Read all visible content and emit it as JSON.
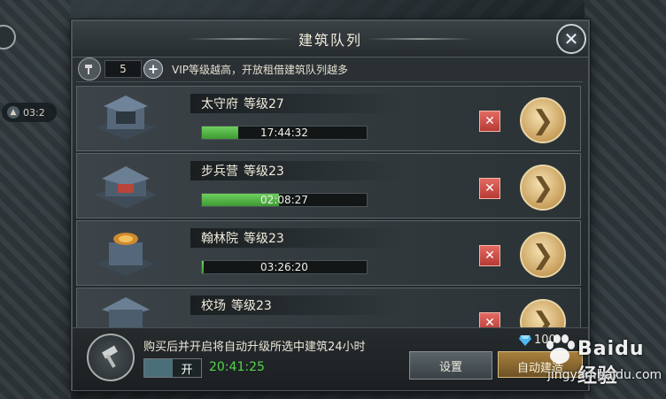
{
  "dialog": {
    "title": "建筑队列"
  },
  "queue_info": {
    "count": "5",
    "vip_note": "VIP等级越高，开放租借建筑队列越多"
  },
  "background": {
    "ghost_timer": "03:2"
  },
  "buildings": [
    {
      "name": "太守府",
      "level": "等级27",
      "timer": "17:44:32",
      "progress": 0.22
    },
    {
      "name": "步兵营",
      "level": "等级23",
      "timer": "02:08:27",
      "progress": 0.47
    },
    {
      "name": "翰林院",
      "level": "等级23",
      "timer": "03:26:20",
      "progress": 0.01
    },
    {
      "name": "校场",
      "level": "等级23",
      "timer": "",
      "progress": 0
    }
  ],
  "footer": {
    "description": "购买后并开启将自动升级所选中建筑24小时",
    "toggle_label": "开",
    "countdown": "20:41:25",
    "settings_label": "设置",
    "gem_cost": "100",
    "auto_build_label": "自动建造"
  },
  "watermark": {
    "brand": "Baidu 经验",
    "url": "jingyan.baidu.com"
  },
  "colors": {
    "progress_green": "#4caf3c",
    "countdown_green": "#57d44a",
    "cancel_red": "#c9473f",
    "gold": "#c89f5d"
  }
}
